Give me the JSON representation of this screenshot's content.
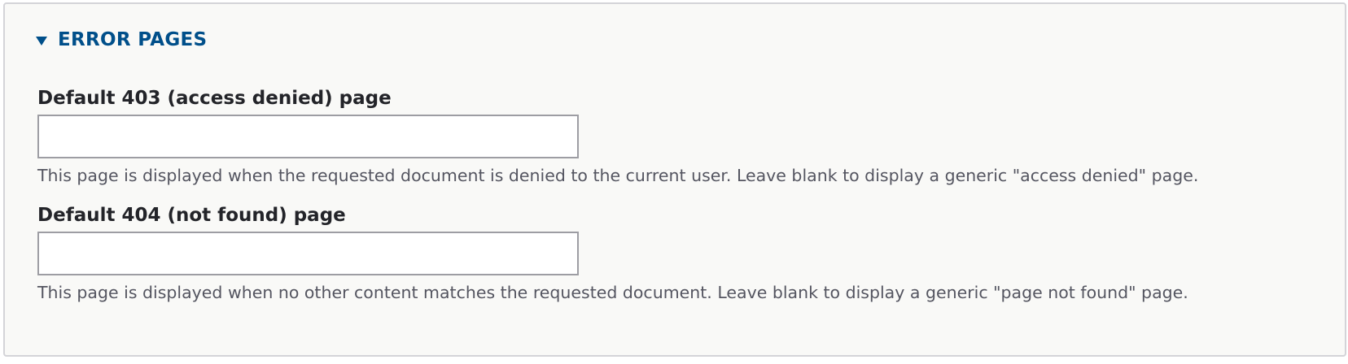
{
  "section": {
    "title": "ERROR PAGES",
    "expanded": true
  },
  "fields": [
    {
      "label": "Default 403 (access denied) page",
      "value": "",
      "description": "This page is displayed when the requested document is denied to the current user. Leave blank to display a generic \"access denied\" page."
    },
    {
      "label": "Default 404 (not found) page",
      "value": "",
      "description": "This page is displayed when no other content matches the requested document. Leave blank to display a generic \"page not found\" page."
    }
  ],
  "colors": {
    "summary_link": "#004f8a",
    "panel_background": "#f9f9f7",
    "panel_border": "#d4d4d8",
    "input_border": "#9d9da3",
    "label_text": "#232429",
    "description_text": "#545560"
  },
  "icons": {
    "summary_toggle": "triangle-down-icon"
  }
}
